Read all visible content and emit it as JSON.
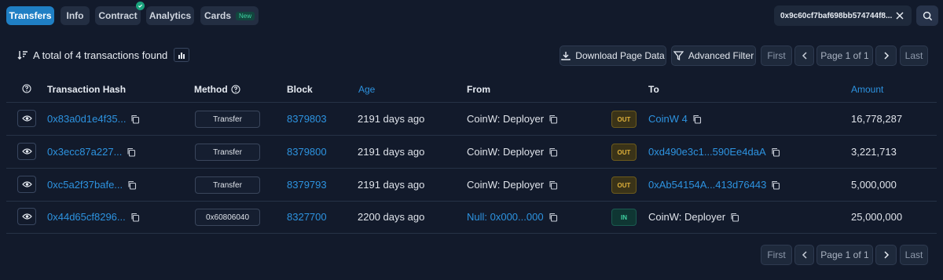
{
  "tabs": [
    {
      "label": "Transfers"
    },
    {
      "label": "Info"
    },
    {
      "label": "Contract"
    },
    {
      "label": "Analytics"
    },
    {
      "label": "Cards",
      "badge": "New"
    }
  ],
  "search": {
    "address": "0x9c60cf7baf698bb574744f8..."
  },
  "summary": {
    "text": "A total of 4 transactions found"
  },
  "toolbar": {
    "download_label": "Download Page Data",
    "filter_label": "Advanced Filter"
  },
  "pager": {
    "first": "First",
    "page": "Page 1 of 1",
    "last": "Last"
  },
  "columns": {
    "hash": "Transaction Hash",
    "method": "Method",
    "block": "Block",
    "age": "Age",
    "from": "From",
    "to": "To",
    "amount": "Amount"
  },
  "rows": [
    {
      "hash": "0x83a0d1e4f35...",
      "method": "Transfer",
      "block": "8379803",
      "age": "2191 days ago",
      "from": "CoinW: Deployer",
      "dir": "OUT",
      "to": "CoinW 4",
      "amount": "16,778,287"
    },
    {
      "hash": "0x3ecc87a227...",
      "method": "Transfer",
      "block": "8379800",
      "age": "2191 days ago",
      "from": "CoinW: Deployer",
      "dir": "OUT",
      "to": "0xd490e3c1...590Ee4daA",
      "amount": "3,221,713"
    },
    {
      "hash": "0xc5a2f37bafe...",
      "method": "Transfer",
      "block": "8379793",
      "age": "2191 days ago",
      "from": "CoinW: Deployer",
      "dir": "OUT",
      "to": "0xAb54154A...413d76443",
      "amount": "5,000,000"
    },
    {
      "hash": "0x44d65cf8296...",
      "method": "0x60806040",
      "block": "8327700",
      "age": "2200 days ago",
      "from": "Null: 0x000...000",
      "dir": "IN",
      "to": "CoinW: Deployer",
      "amount": "25,000,000"
    }
  ],
  "colors": {
    "accent": "#1f7fc4",
    "link": "#2d93e0",
    "out": "#e0b23b",
    "in": "#3fd3a3"
  }
}
